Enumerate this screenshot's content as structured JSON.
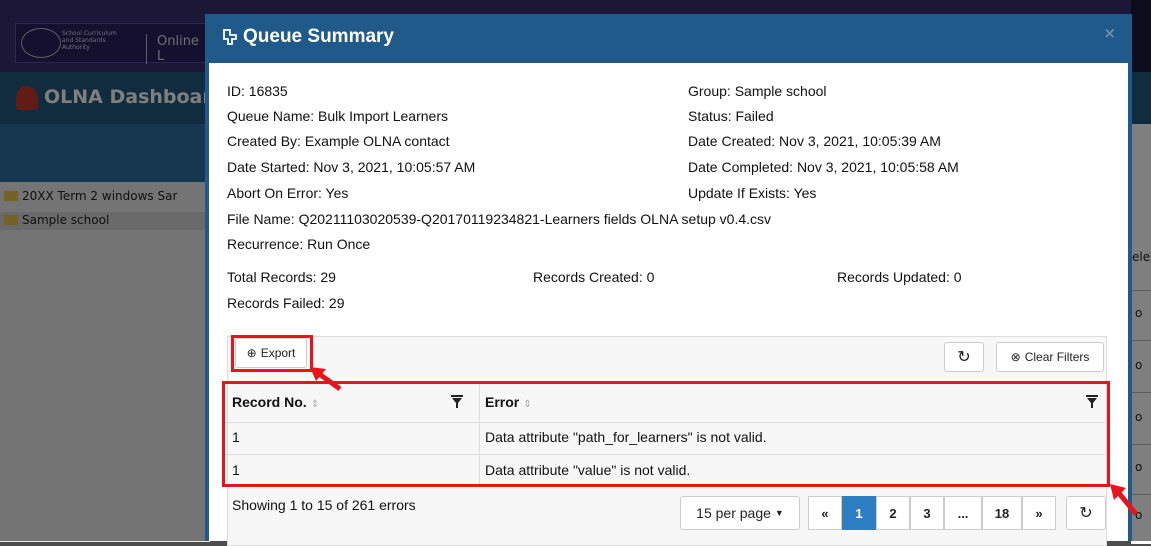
{
  "background": {
    "org_logo_lines": [
      "School Curriculum",
      "and Standards",
      "Authority"
    ],
    "app_name_fragment": "Online L",
    "dashboard_title_fragment": "OLNA Dashboar",
    "tree_items": [
      "20XX Term 2 windows Sar",
      "Sample school"
    ],
    "right_column_fragments": [
      "ele",
      "o",
      "o",
      "o",
      "o",
      "o"
    ]
  },
  "modal": {
    "title": "Queue Summary",
    "close_label": "×",
    "info_left": [
      "ID: 16835",
      "Queue Name: Bulk Import Learners",
      "Created By: Example OLNA contact",
      "Date Started: Nov 3, 2021, 10:05:57 AM",
      "Abort On Error: Yes"
    ],
    "info_right": [
      "Group: Sample school",
      "Status: Failed",
      "Date Created: Nov 3, 2021, 10:05:39 AM",
      "Date Completed: Nov 3, 2021, 10:05:58 AM",
      "Update If Exists: Yes"
    ],
    "file_name": "File Name: Q20211103020539-Q20170119234821-Learners fields OLNA setup v0.4.csv",
    "recurrence": "Recurrence: Run Once",
    "totals": {
      "total_records": "Total Records: 29",
      "records_created": "Records Created: 0",
      "records_updated": "Records Updated: 0",
      "records_failed": "Records Failed: 29"
    }
  },
  "toolbar": {
    "export_label": "Export",
    "clear_filters_label": "Clear Filters"
  },
  "table": {
    "headers": [
      "Record No.",
      "Error"
    ],
    "rows": [
      [
        "1",
        "Data attribute \"path_for_learners\" is not valid."
      ],
      [
        "1",
        "Data attribute \"value\" is not valid."
      ]
    ]
  },
  "footer": {
    "showing_text": "Showing 1 to 15 of 261 errors",
    "per_page_label": "15 per page",
    "pages": [
      "«",
      "1",
      "2",
      "3",
      "...",
      "18",
      "»"
    ],
    "active_page": "1"
  },
  "colors": {
    "header_blue": "#1f5a8a",
    "highlight_red": "#e8131b",
    "active_page_blue": "#2e7fc1"
  }
}
